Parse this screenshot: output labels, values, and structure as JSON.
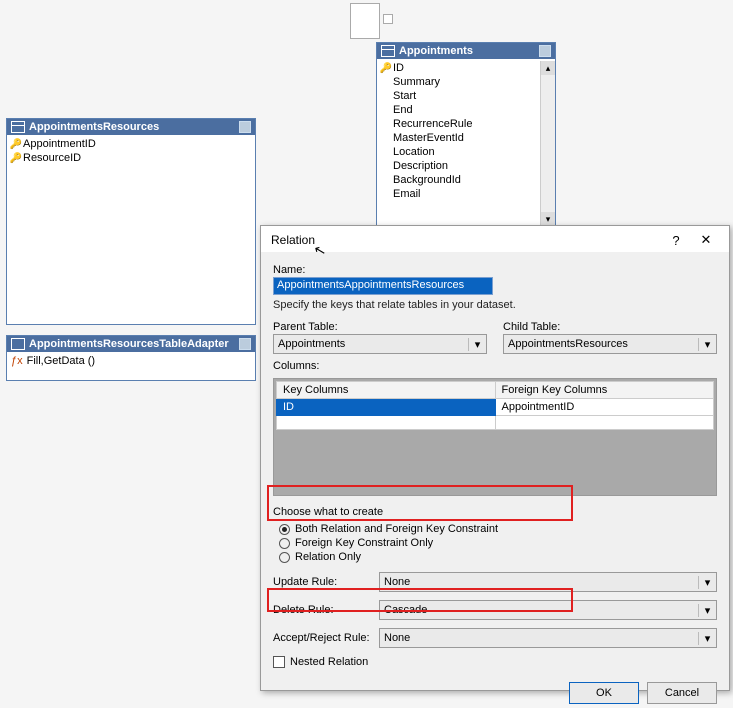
{
  "designer": {
    "table1": {
      "title": "AppointmentsResources",
      "columns": [
        "AppointmentID",
        "ResourceID"
      ],
      "keys": [
        true,
        true
      ]
    },
    "table2": {
      "title": "Appointments",
      "columns": [
        "ID",
        "Summary",
        "Start",
        "End",
        "RecurrenceRule",
        "MasterEventId",
        "Location",
        "Description",
        "BackgroundId",
        "Email"
      ],
      "keys": [
        true,
        false,
        false,
        false,
        false,
        false,
        false,
        false,
        false,
        false
      ]
    },
    "adapter": {
      "title": "AppointmentsResourcesTableAdapter",
      "method": "Fill,GetData ()"
    }
  },
  "dialog": {
    "title": "Relation",
    "name_label": "Name:",
    "name_value": "AppointmentsAppointmentsResources",
    "hint": "Specify the keys that relate tables in your dataset.",
    "parent_label": "Parent Table:",
    "parent_value": "Appointments",
    "child_label": "Child Table:",
    "child_value": "AppointmentsResources",
    "columns_label": "Columns:",
    "col_key_header": "Key Columns",
    "col_fk_header": "Foreign Key Columns",
    "row_key": "ID",
    "row_fk": "AppointmentID",
    "choose_label": "Choose what to create",
    "opt_both": "Both Relation and Foreign Key Constraint",
    "opt_fk": "Foreign Key Constraint Only",
    "opt_rel": "Relation Only",
    "update_label": "Update Rule:",
    "update_value": "None",
    "delete_label": "Delete Rule:",
    "delete_value": "Cascade",
    "accept_label": "Accept/Reject Rule:",
    "accept_value": "None",
    "nested_label": "Nested Relation",
    "ok": "OK",
    "cancel": "Cancel",
    "help": "?",
    "close": "✕"
  }
}
